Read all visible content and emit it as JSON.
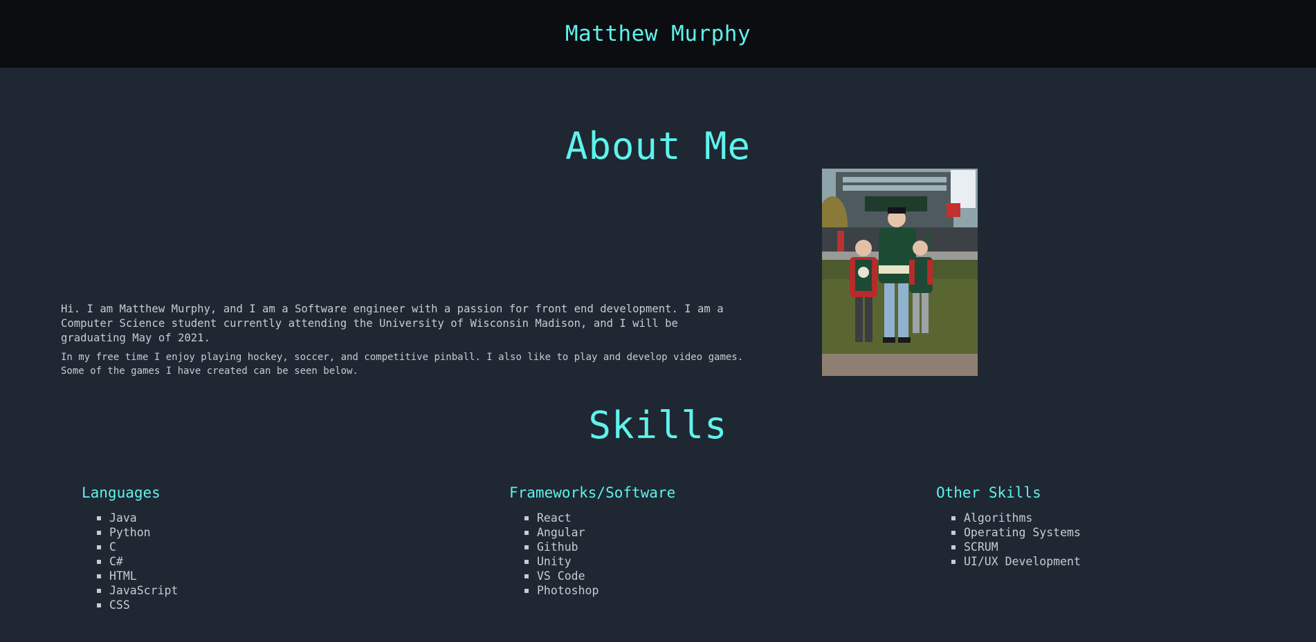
{
  "header": {
    "title": "Matthew Murphy"
  },
  "about": {
    "heading": "About Me",
    "paragraph1": "Hi. I am Matthew Murphy, and I am a Software engineer with a passion for front end development. I am a Computer Science student currently attending the University of Wisconsin Madison, and I will be graduating May of 2021.",
    "paragraph2": "In my free time I enjoy playing hockey, soccer, and competitive pinball. I also like to play and develop video games. Some of the games I have created can be seen below."
  },
  "skills": {
    "heading": "Skills",
    "columns": [
      {
        "title": "Languages",
        "items": [
          "Java",
          "Python",
          "C",
          "C#",
          "HTML",
          "JavaScript",
          "CSS"
        ]
      },
      {
        "title": "Frameworks/Software",
        "items": [
          "React",
          "Angular",
          "Github",
          "Unity",
          "VS Code",
          "Photoshop"
        ]
      },
      {
        "title": "Other Skills",
        "items": [
          "Algorithms",
          "Operating Systems",
          "SCRUM",
          "UI/UX Development"
        ]
      }
    ]
  },
  "colors": {
    "accent": "#5ff3ec",
    "header_bg": "#0b0d11",
    "page_bg": "#1f2732",
    "text": "#c8ccd2"
  }
}
